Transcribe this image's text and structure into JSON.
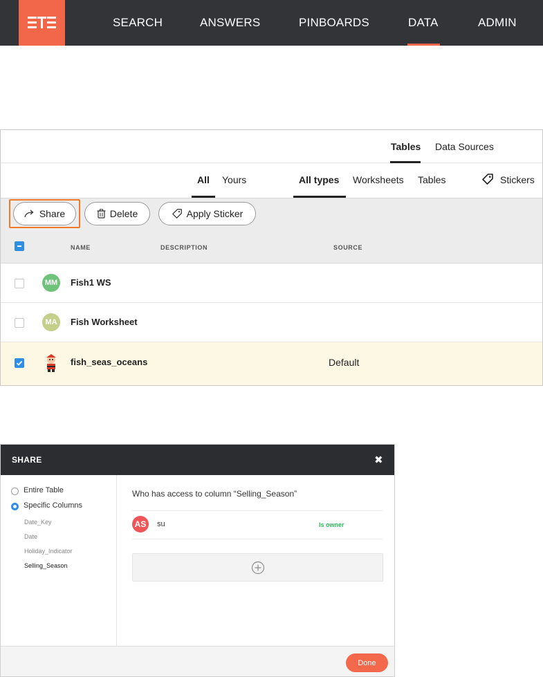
{
  "nav": {
    "items": [
      "SEARCH",
      "ANSWERS",
      "PINBOARDS",
      "DATA",
      "ADMIN"
    ],
    "active": "DATA",
    "accent": "#f2664a",
    "logo_icon": "thoughtspot-logo-icon"
  },
  "data_panel": {
    "top_tabs": [
      "Tables",
      "Data Sources"
    ],
    "active_top_tab": "Tables",
    "owner_filters": [
      "All",
      "Yours"
    ],
    "active_owner_filter": "All",
    "type_filters": [
      "All types",
      "Worksheets",
      "Tables"
    ],
    "active_type_filter": "All types",
    "stickers_label": "Stickers",
    "toolbar": {
      "share_label": "Share",
      "delete_label": "Delete",
      "apply_sticker_label": "Apply Sticker"
    },
    "columns": [
      "NAME",
      "DESCRIPTION",
      "SOURCE"
    ],
    "rows": [
      {
        "initials": "MM",
        "name": "Fish1 WS",
        "description": "",
        "source": "",
        "checked": false,
        "avatar_color": "#6fc27a"
      },
      {
        "initials": "MA",
        "name": "Fish Worksheet",
        "description": "",
        "source": "",
        "checked": false,
        "avatar_color": "#c3cf8a"
      },
      {
        "initials": "",
        "name": "fish_seas_oceans",
        "description": "",
        "source": "Default",
        "checked": true,
        "avatar_icon": "character-avatar-icon"
      }
    ]
  },
  "share_dialog": {
    "title": "SHARE",
    "close": "✖",
    "options": [
      "Entire Table",
      "Specific Columns"
    ],
    "selected_option": "Specific Columns",
    "columns": [
      "Date_Key",
      "Date",
      "Holiday_Indicator",
      "Selling_Season"
    ],
    "selected_column": "Selling_Season",
    "question": "Who has access to column “Selling_Season”",
    "user": {
      "initials": "AS",
      "name": "su",
      "role": "Is owner"
    },
    "add_icon": "plus-circle-icon",
    "done_label": "Done"
  }
}
